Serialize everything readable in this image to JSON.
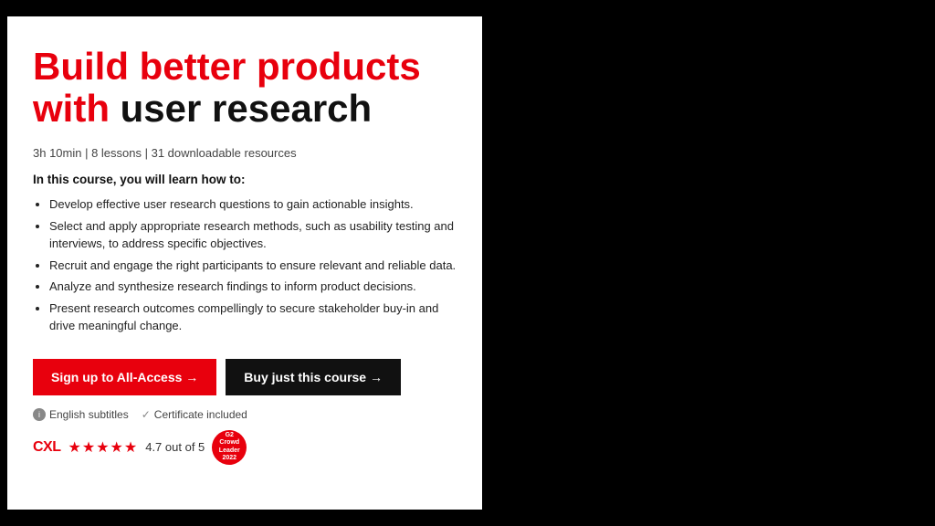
{
  "card": {
    "title": {
      "red_part": "Build better products with ",
      "black_part": "user research"
    },
    "meta": "3h 10min | 8 lessons | 31 downloadable resources",
    "intro_label": "In this course, you will learn how to:",
    "bullets": [
      "Develop effective user research questions to gain actionable insights.",
      "Select and apply appropriate research methods, such as usability testing and interviews, to address specific objectives.",
      "Recruit and engage the right participants to ensure relevant and reliable data.",
      "Analyze and synthesize research findings to inform product decisions.",
      "Present research outcomes compellingly to secure stakeholder buy-in and drive meaningful change."
    ],
    "cta_primary": "Sign up to All-Access  →",
    "cta_secondary": "Buy just this course  →",
    "subtitles_label": "English subtitles",
    "certificate_label": "Certificate included",
    "cxl_label": "CXL",
    "rating_value": "4.7 out of 5",
    "award_lines": [
      "G2",
      "Crowd",
      "Leader",
      "2022"
    ],
    "stars_symbol": "★★★★★"
  },
  "colors": {
    "red": "#e8000d",
    "dark": "#111111"
  }
}
